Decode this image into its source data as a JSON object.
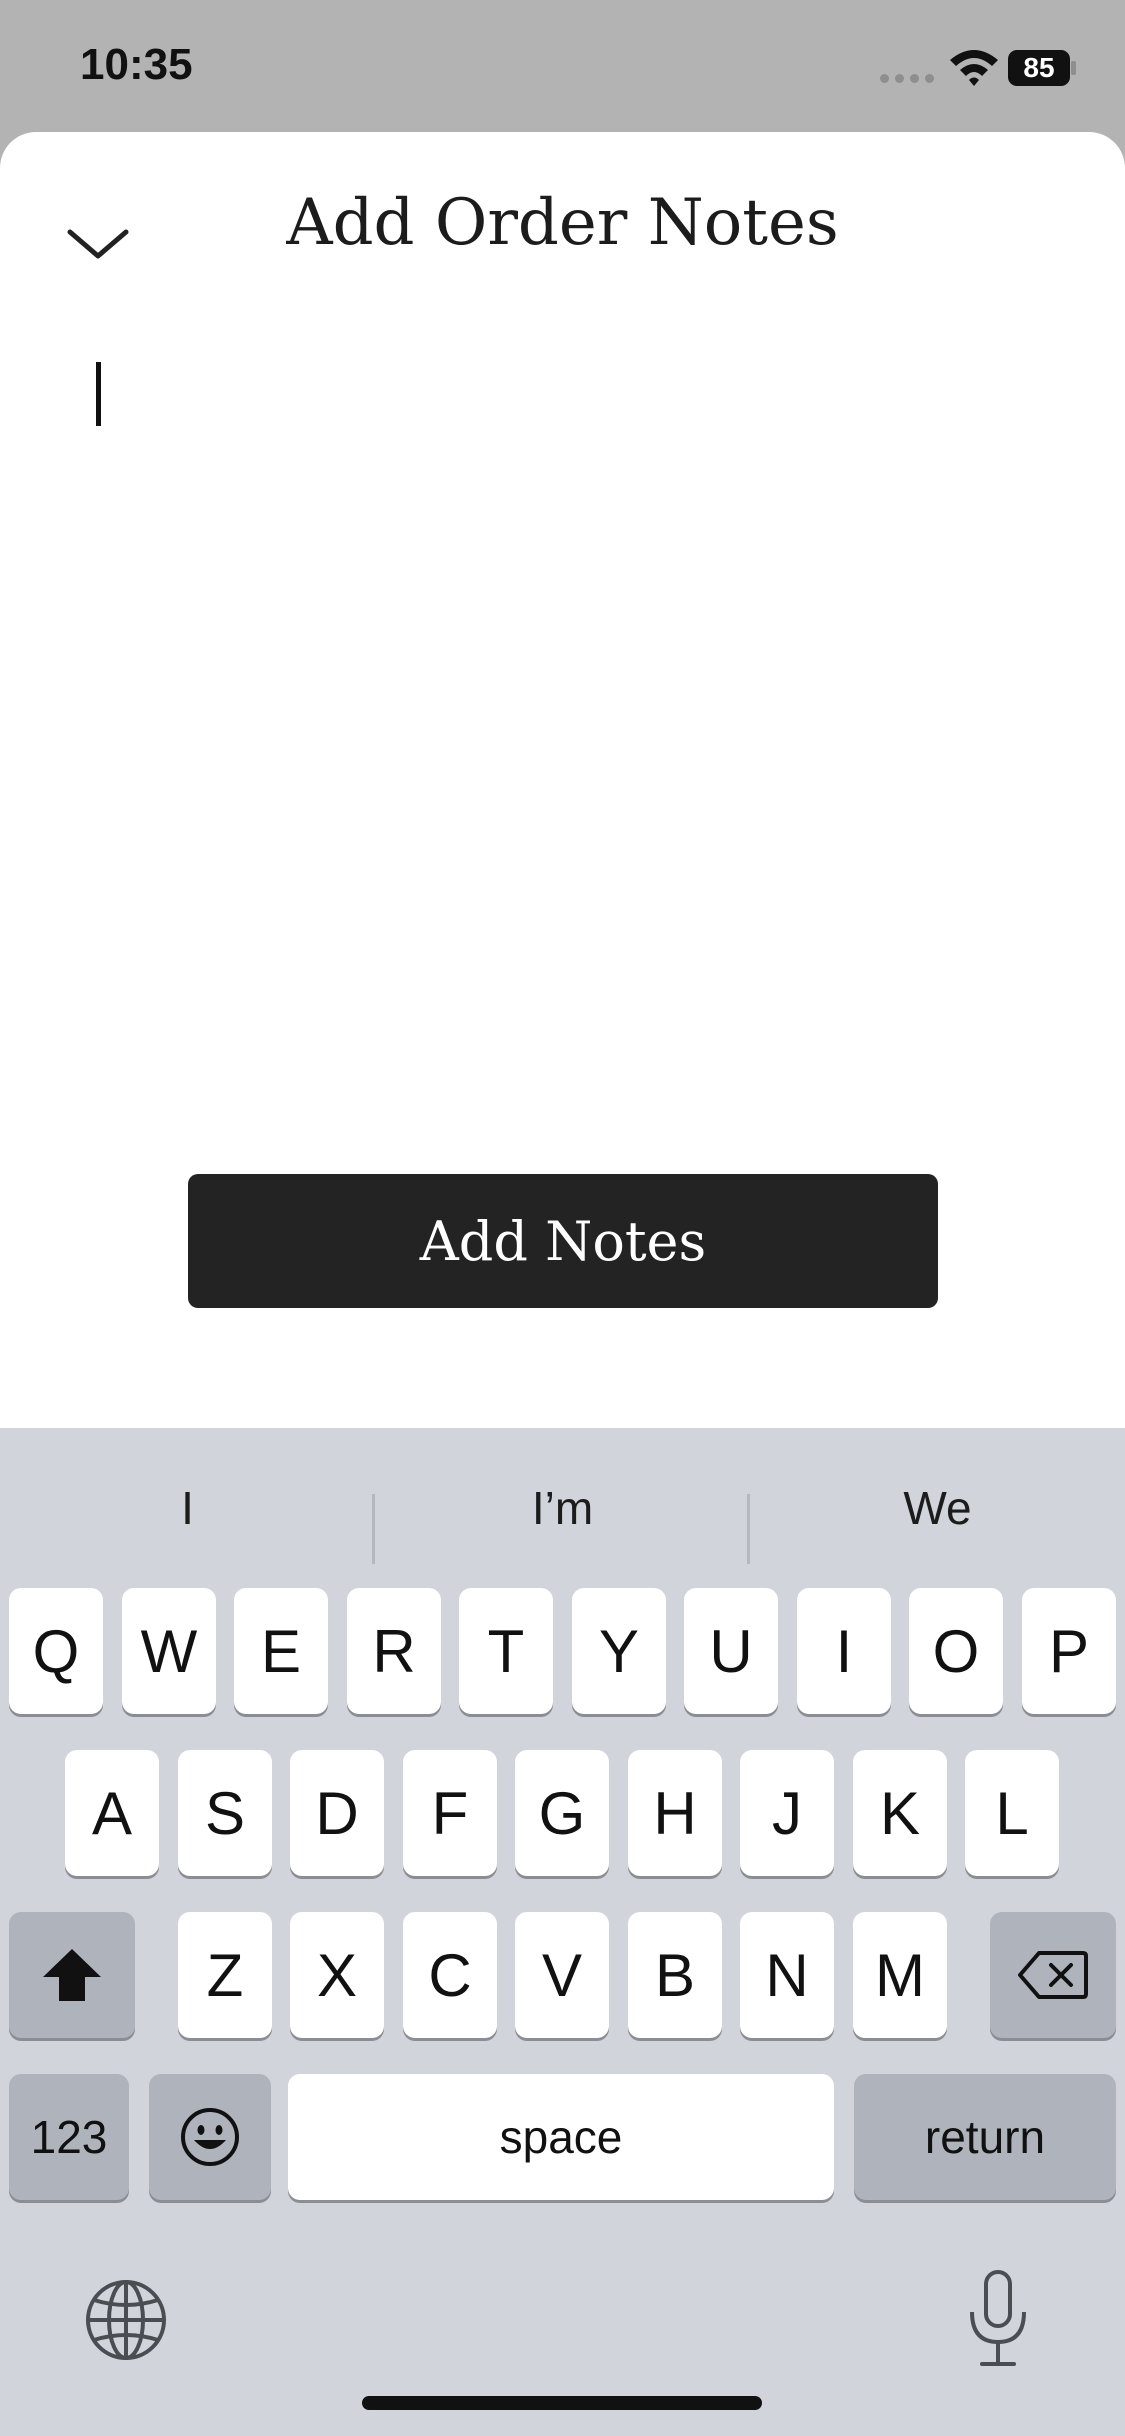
{
  "status_bar": {
    "time": "10:35",
    "battery": "85"
  },
  "sheet": {
    "title": "Add Order Notes",
    "notes_value": "",
    "add_button_label": "Add Notes"
  },
  "keyboard": {
    "suggestions": [
      "I",
      "I’m",
      "We"
    ],
    "row1": [
      "Q",
      "W",
      "E",
      "R",
      "T",
      "Y",
      "U",
      "I",
      "O",
      "P"
    ],
    "row2": [
      "A",
      "S",
      "D",
      "F",
      "G",
      "H",
      "J",
      "K",
      "L"
    ],
    "row3": [
      "Z",
      "X",
      "C",
      "V",
      "B",
      "N",
      "M"
    ],
    "numbers_label": "123",
    "space_label": "space",
    "return_label": "return"
  },
  "icons": {
    "collapse": "chevron-down-icon",
    "shift": "shift-icon",
    "backspace": "backspace-icon",
    "emoji": "emoji-icon",
    "globe": "globe-icon",
    "mic": "microphone-icon"
  }
}
